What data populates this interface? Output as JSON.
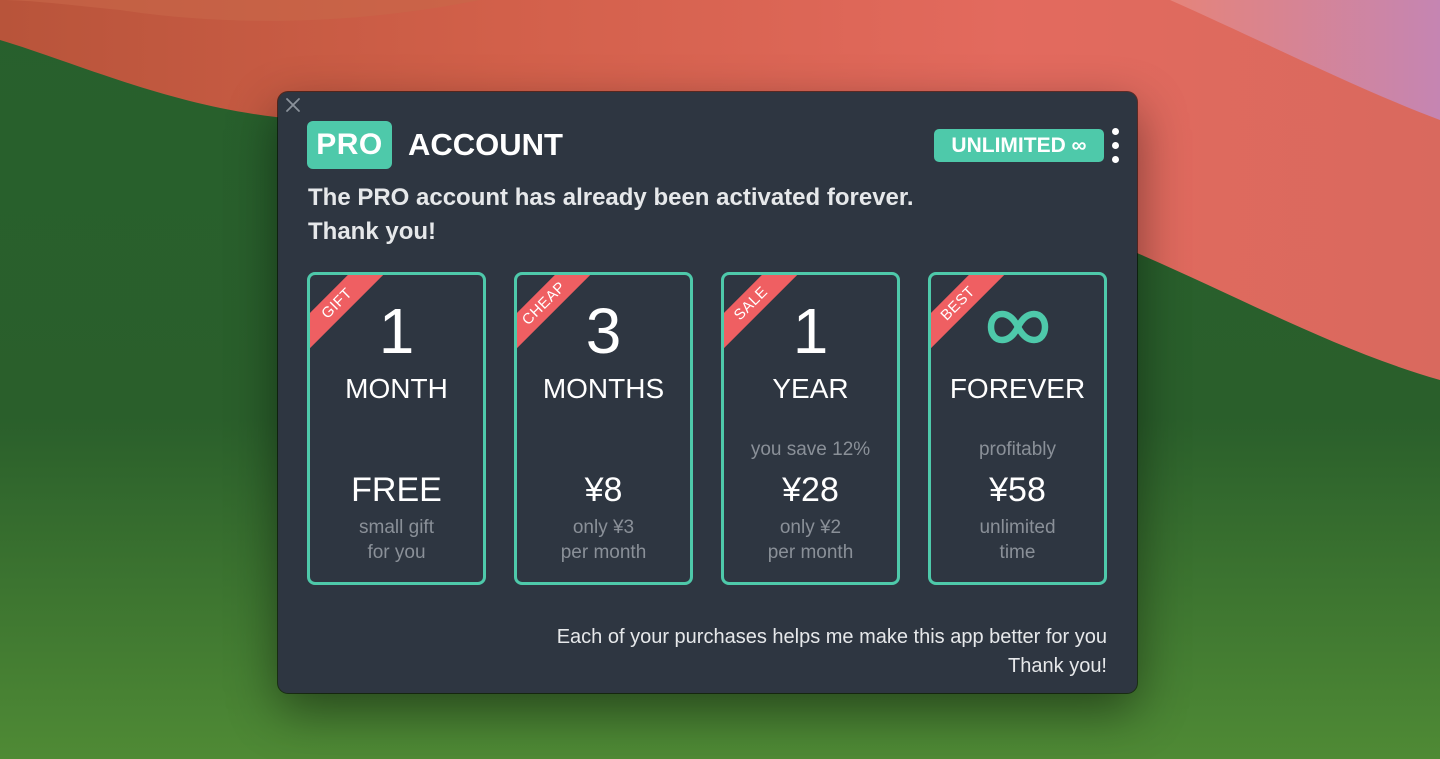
{
  "header": {
    "badge": "PRO",
    "title": "ACCOUNT",
    "status_badge": "UNLIMITED ∞"
  },
  "message": {
    "line1": "The PRO account has already been activated forever.",
    "line2": "Thank you!"
  },
  "plans": [
    {
      "ribbon": "GIFT",
      "amount": "1",
      "period": "MONTH",
      "note": "",
      "price": "FREE",
      "sub1": "small gift",
      "sub2": "for you"
    },
    {
      "ribbon": "CHEAP",
      "amount": "3",
      "period": "MONTHS",
      "note": "",
      "price": "¥8",
      "sub1": "only ¥3",
      "sub2": "per month"
    },
    {
      "ribbon": "SALE",
      "amount": "1",
      "period": "YEAR",
      "note": "you save 12%",
      "price": "¥28",
      "sub1": "only ¥2",
      "sub2": "per month"
    },
    {
      "ribbon": "BEST",
      "amount_icon": "infinity-icon",
      "period": "FOREVER",
      "note": "profitably",
      "price": "¥58",
      "sub1": "unlimited",
      "sub2": "time"
    }
  ],
  "footer": {
    "line1": "Each of your purchases helps me make this app better for you",
    "line2": "Thank you!"
  },
  "colors": {
    "accent": "#4ec9aa",
    "ribbon": "#ef5f62",
    "panel": "#2e3641",
    "muted_text": "#8a9098"
  }
}
